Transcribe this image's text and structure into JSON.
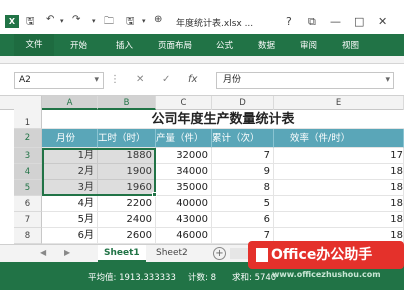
{
  "window": {
    "app_icon": "X",
    "title": "年度统计表.xlsx ...",
    "help": "?",
    "restore": "⧉",
    "minimize": "—",
    "maximize": "□",
    "close": "✕"
  },
  "ribbon": {
    "tabs": [
      "文件",
      "开始",
      "插入",
      "页面布局",
      "公式",
      "数据",
      "审阅",
      "视图"
    ]
  },
  "formula_bar": {
    "name_box": "A2",
    "fx": "fx",
    "value": "月份"
  },
  "columns": [
    "A",
    "B",
    "C",
    "D",
    "E"
  ],
  "rows": [
    "1",
    "2",
    "3",
    "4",
    "5",
    "6",
    "7",
    "8"
  ],
  "sheet": {
    "title": "公司年度生产数量统计表",
    "headers": [
      "月份",
      "工时（时）",
      "产量（件）",
      "累计（次）",
      "效率（件/时）"
    ],
    "data": [
      [
        "1月",
        "1880",
        "32000",
        "7",
        "17"
      ],
      [
        "2月",
        "1900",
        "34000",
        "9",
        "18"
      ],
      [
        "3月",
        "1960",
        "35000",
        "8",
        "18"
      ],
      [
        "4月",
        "2200",
        "40000",
        "5",
        "18"
      ],
      [
        "5月",
        "2400",
        "43000",
        "6",
        "18"
      ],
      [
        "6月",
        "2600",
        "46000",
        "7",
        "18"
      ]
    ]
  },
  "sheet_tabs": [
    "Sheet1",
    "Sheet2"
  ],
  "add_sheet": "+",
  "status": {
    "average": "平均值: 1913.333333",
    "count": "计数: 8",
    "sum": "求和: 5740"
  },
  "watermark": {
    "text": "Office办公助手",
    "url": "www.officezhushou.com"
  }
}
